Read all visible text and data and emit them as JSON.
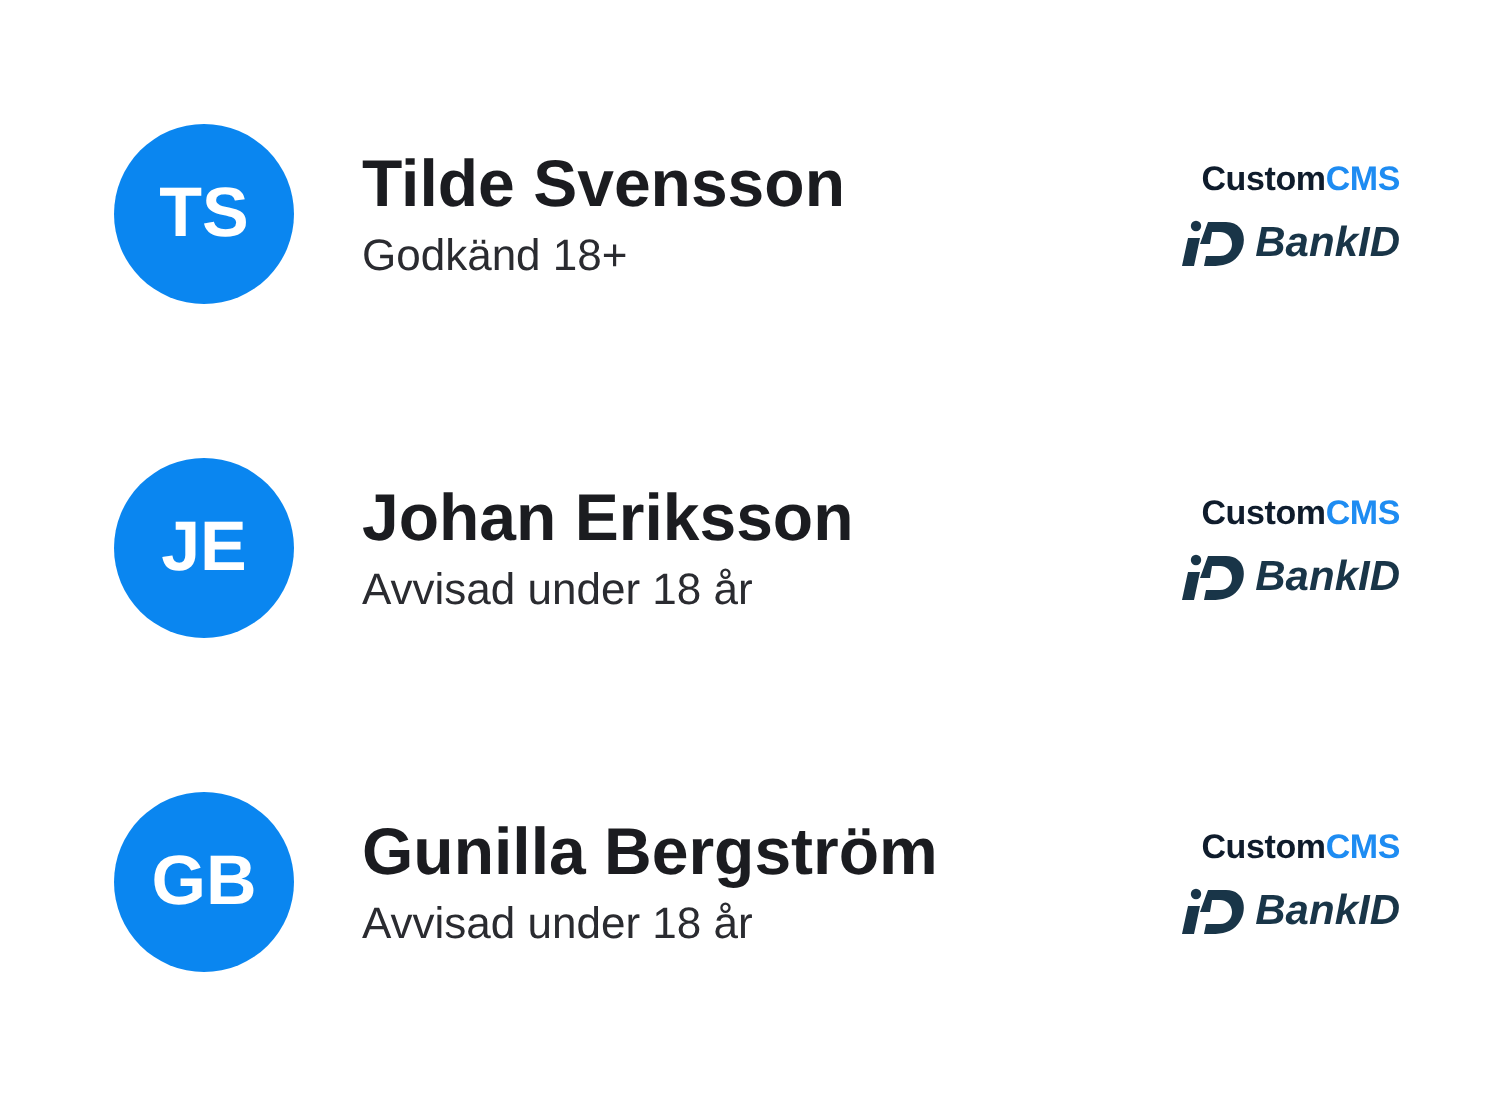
{
  "people": [
    {
      "initials": "TS",
      "name": "Tilde Svensson",
      "status": "Godkänd 18+",
      "provider": {
        "brand": "Custom",
        "brand_accent": "CMS",
        "method": "BankID"
      }
    },
    {
      "initials": "JE",
      "name": "Johan Eriksson",
      "status": "Avvisad under 18 år",
      "provider": {
        "brand": "Custom",
        "brand_accent": "CMS",
        "method": "BankID"
      }
    },
    {
      "initials": "GB",
      "name": "Gunilla Bergström",
      "status": "Avvisad under 18 år",
      "provider": {
        "brand": "Custom",
        "brand_accent": "CMS",
        "method": "BankID"
      }
    }
  ]
}
